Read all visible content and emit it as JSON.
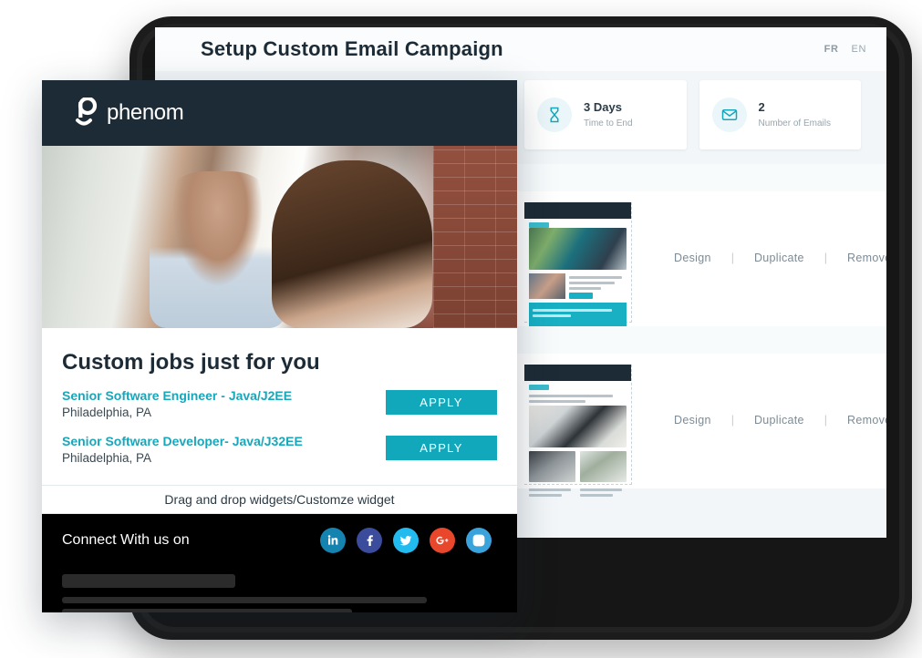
{
  "app": {
    "title": "Setup Custom Email Campaign",
    "languages": [
      {
        "code": "FR",
        "active": true
      },
      {
        "code": "EN",
        "active": false
      }
    ],
    "stats": [
      {
        "icon": "hourglass-icon",
        "value": "3 Days",
        "label": "Time to End"
      },
      {
        "icon": "envelope-icon",
        "value": "2",
        "label": "Number of Emails"
      }
    ],
    "templates": [
      {
        "actions": [
          {
            "label": "Design"
          },
          {
            "label": "Duplicate"
          },
          {
            "label": "Remove"
          }
        ],
        "separator": "|"
      },
      {
        "actions": [
          {
            "label": "Design"
          },
          {
            "label": "Duplicate"
          },
          {
            "label": "Remove"
          }
        ],
        "separator": "|"
      }
    ]
  },
  "preview": {
    "brand": "phenom",
    "heading": "Custom jobs just for you",
    "jobs": [
      {
        "title": "Senior Software Engineer - Java/J2EE",
        "location": "Philadelphia, PA",
        "apply_label": "APPLY"
      },
      {
        "title": "Senior Software Developer- Java/J32EE",
        "location": "Philadelphia, PA",
        "apply_label": "APPLY"
      }
    ],
    "dragdrop_text": "Drag and drop widgets/Customze widget",
    "social_label": "Connect With us on",
    "socials": [
      {
        "name": "linkedin-icon",
        "glyph": "in"
      },
      {
        "name": "facebook-icon",
        "glyph": "f"
      },
      {
        "name": "twitter-icon",
        "glyph": "t"
      },
      {
        "name": "googleplus-icon",
        "glyph": "g+"
      },
      {
        "name": "instagram-icon",
        "glyph": "ig"
      }
    ]
  },
  "colors": {
    "accent_teal": "#12a8bb",
    "dark_navy": "#1d2b36",
    "page_bg": "#f2f6f8",
    "link_teal": "#17a7bb"
  }
}
